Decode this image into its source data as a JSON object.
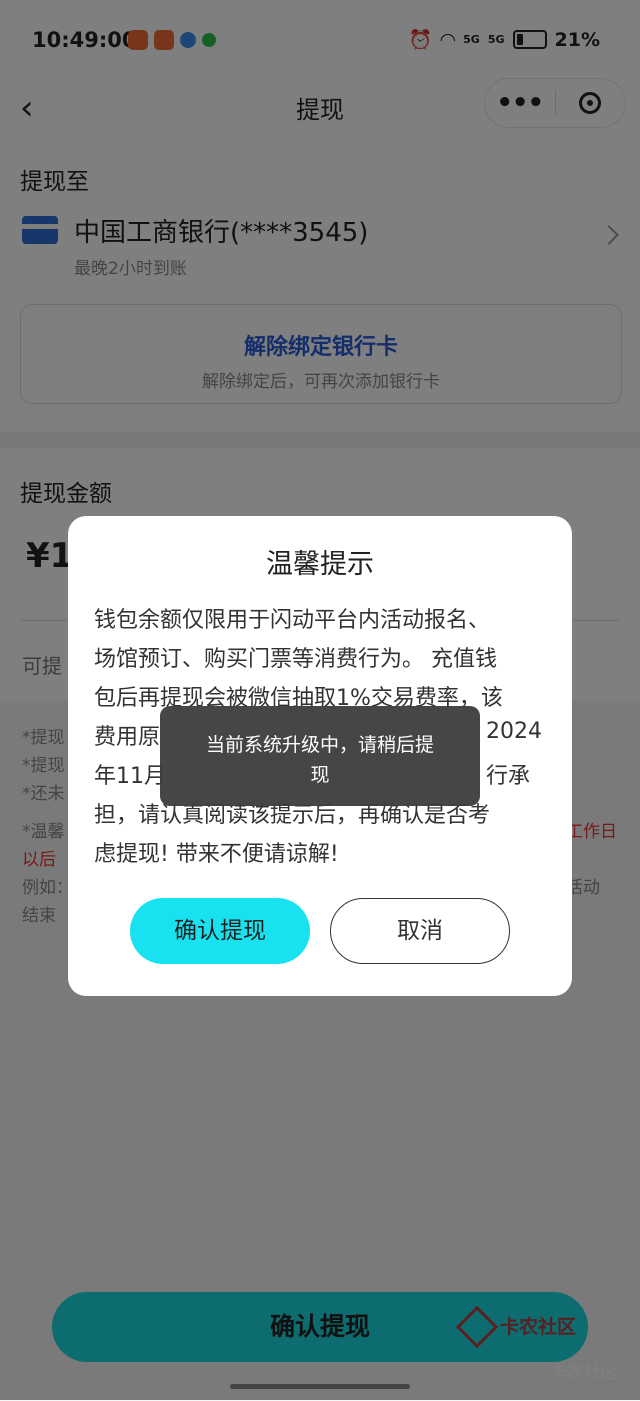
{
  "status": {
    "time": "10:49:00",
    "net1": "5G",
    "net2": "5G",
    "battery": "21%"
  },
  "nav": {
    "title": "提现",
    "back_icon": "chevron-left-icon",
    "more_icon": "more-icon",
    "close_icon": "target-icon"
  },
  "withdraw_to": {
    "section_title": "提现至",
    "bank_name": "中国工商银行(****3545)",
    "arrival": "最晚2小时到账",
    "unbind_title": "解除绑定银行卡",
    "unbind_sub": "解除绑定后，可再次添加银行卡"
  },
  "amount": {
    "section_title": "提现金额",
    "prefix": "¥1",
    "available_label": "可提"
  },
  "notes": {
    "n1": "*提现",
    "n2": "*提现",
    "n3": "*还未",
    "n4": "*温馨",
    "n4_right": "工作日",
    "n5": "以后",
    "n6": "例如：",
    "n6_right": "活动",
    "n7": "结束"
  },
  "dialog": {
    "title": "温馨提示",
    "lines": [
      "钱包余额仅限用于闪动平台内活动报名、",
      "场馆预订、购买门票等消费行为。 充值钱",
      "包后再提现会被微信抽取1%交易费率，该",
      "费用原",
      "年11月",
      "担，请认真阅读该提示后，再确认是否考",
      "虑提现! 带来不便请谅解!"
    ],
    "line4_right": "2024",
    "line5_right": "行承",
    "confirm": "确认提现",
    "cancel": "取消"
  },
  "toast": {
    "line1": "当前系统升级中，请稍后提",
    "line2": "现"
  },
  "bottom": {
    "confirm": "确认提现"
  },
  "watermark": {
    "logo_text": "卡农社区",
    "corner_text": "卡农社区"
  },
  "colors": {
    "accent": "#18e2f0",
    "link": "#2a5bd7",
    "warning": "#e33333"
  }
}
